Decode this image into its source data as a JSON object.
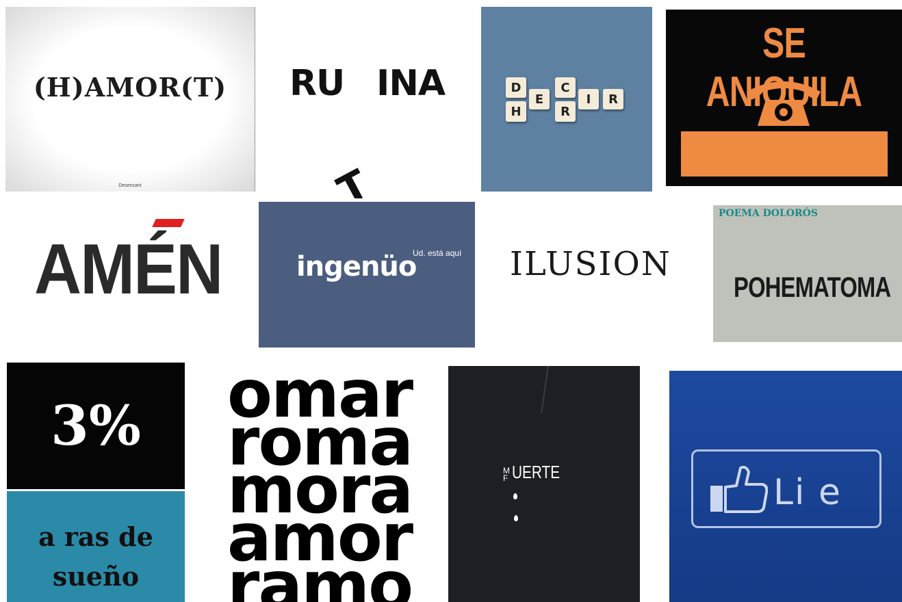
{
  "tiles": {
    "hamort": {
      "text": "(H)AMOR(T)",
      "signature": "Desencant"
    },
    "ruina": {
      "left": "RU",
      "right": "INA",
      "fallen": "T"
    },
    "decir": {
      "row1": [
        "D",
        "E",
        "C",
        "I",
        "R"
      ],
      "row2_letters": [
        "H",
        "R"
      ],
      "colors": {
        "bg": "#5e80a1",
        "tile": "#f4ecd8"
      }
    },
    "aniquila": {
      "title": "SE ANIQUILA",
      "icon": "telephone-icon",
      "colors": {
        "bg": "#080808",
        "accent": "#ef8a43"
      }
    },
    "amen": {
      "text": "AMÉN",
      "accent_color": "#e02020"
    },
    "ingenuo": {
      "text": "ingenüo",
      "note": "Ud. está aquí",
      "bg": "#4b5e80"
    },
    "ilusion": {
      "text": "ILUSION"
    },
    "poema": {
      "title": "POEMA DOLORÓS",
      "word": "POHEMATOMA"
    },
    "percent": {
      "value": "3%",
      "caption_line1": "a ras de",
      "caption_line2": "sueño",
      "caption_bg": "#2b8aa8"
    },
    "omar": {
      "lines": [
        "omar",
        "roma",
        "mora",
        "amor",
        "ramo"
      ]
    },
    "muerte": {
      "stacked_m": "M",
      "stacked_f": "F",
      "word": "UERTE"
    },
    "like": {
      "text": "Li e",
      "icon": "thumbs-up-icon",
      "bg": "#1d4aa0"
    }
  }
}
